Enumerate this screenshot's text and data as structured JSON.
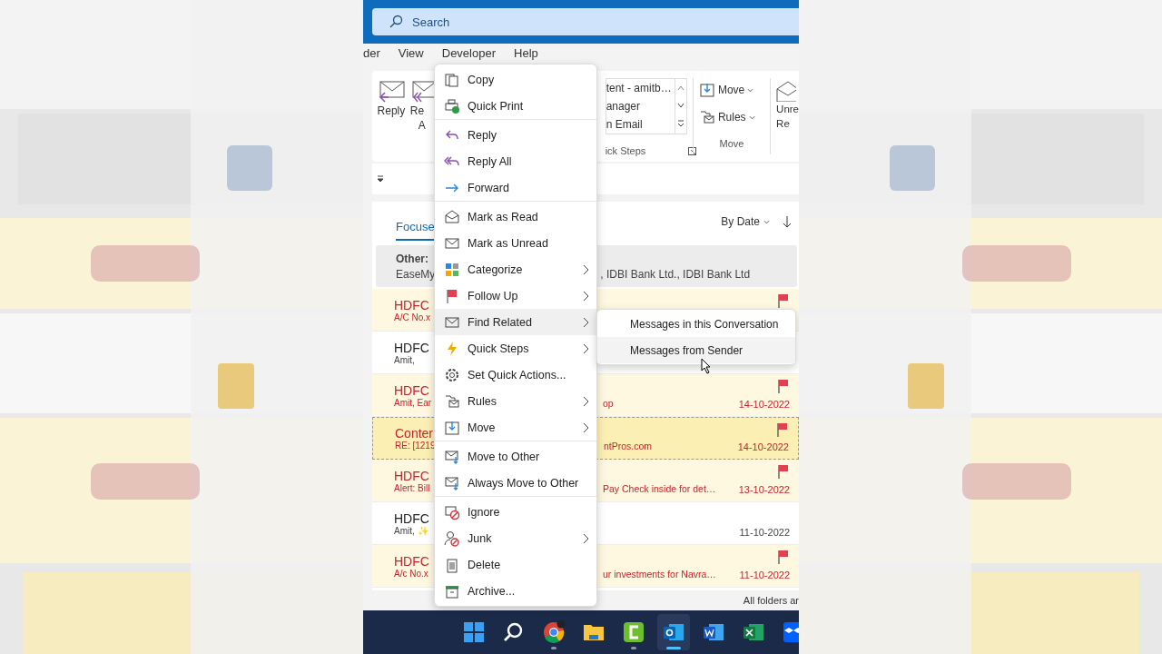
{
  "search": {
    "placeholder": "Search"
  },
  "menu_tabs": [
    "der",
    "View",
    "Developer",
    "Help"
  ],
  "ribbon": {
    "reply": "Reply",
    "reply_all_lines": [
      "Re",
      "A"
    ],
    "quick_steps": {
      "items": [
        "tent - amitb…",
        "anager",
        "n Email"
      ],
      "label": "ick Steps"
    },
    "move_group": {
      "items": [
        {
          "kind": "move",
          "label": "Move"
        },
        {
          "kind": "rules",
          "label": "Rules"
        }
      ],
      "label": "Move"
    },
    "unread_lines": [
      "Unre",
      "Re"
    ]
  },
  "message_list": {
    "tab": "Focuse",
    "sort": "By Date",
    "other": {
      "label": "Other:",
      "senders_start": "EaseMy",
      "senders_end": ", IDBI Bank Ltd., IDBI Bank Ltd"
    },
    "rows": [
      {
        "sender": "HDFC",
        "preview": "A/C No.x",
        "flagged": true,
        "unread": true,
        "selected": false
      },
      {
        "sender": "HDFC",
        "preview": "Amit,",
        "flagged": false,
        "unread": false,
        "selected": false
      },
      {
        "sender": "HDFC",
        "preview": "Amit, Ear",
        "tail": "op",
        "date": "14-10-2022",
        "flagged": true,
        "unread": true,
        "selected": false
      },
      {
        "sender": "Conter",
        "preview": "RE: [1219",
        "tail": "ntPros.com",
        "date": "14-10-2022",
        "flagged": true,
        "unread": true,
        "selected": true
      },
      {
        "sender": "HDFC",
        "preview": "Alert: Bill",
        "tail": "Pay Check inside for det…",
        "date": "13-10-2022",
        "flagged": true,
        "unread": true,
        "selected": false
      },
      {
        "sender": "HDFC",
        "preview": "Amit, ✨",
        "date": "11-10-2022",
        "flagged": false,
        "unread": false,
        "selected": false
      },
      {
        "sender": "HDFC",
        "preview": "A/c No.x",
        "tail": "ur investments for Navra…",
        "date": "11-10-2022",
        "flagged": true,
        "unread": true,
        "selected": false
      }
    ]
  },
  "status_bar": "All folders ar",
  "context_menu": {
    "items": [
      {
        "kind": "copy",
        "label": "Copy",
        "submenu": false,
        "selected": false,
        "separator_after": false
      },
      {
        "kind": "print",
        "label": "Quick Print",
        "submenu": false,
        "selected": false,
        "separator_after": true
      },
      {
        "kind": "reply",
        "label": "Reply",
        "submenu": false,
        "selected": false,
        "separator_after": false
      },
      {
        "kind": "replyall",
        "label": "Reply All",
        "submenu": false,
        "selected": false,
        "separator_after": false
      },
      {
        "kind": "forward",
        "label": "Forward",
        "submenu": false,
        "selected": false,
        "separator_after": true
      },
      {
        "kind": "read",
        "label": "Mark as Read",
        "submenu": false,
        "selected": false,
        "separator_after": false
      },
      {
        "kind": "unread",
        "label": "Mark as Unread",
        "submenu": false,
        "selected": false,
        "separator_after": false
      },
      {
        "kind": "categorize",
        "label": "Categorize",
        "submenu": true,
        "selected": false,
        "separator_after": false
      },
      {
        "kind": "flag",
        "label": "Follow Up",
        "submenu": true,
        "selected": false,
        "separator_after": false
      },
      {
        "kind": "find",
        "label": "Find Related",
        "submenu": true,
        "selected": true,
        "separator_after": false
      },
      {
        "kind": "quicksteps",
        "label": "Quick Steps",
        "submenu": true,
        "selected": false,
        "separator_after": false
      },
      {
        "kind": "gear",
        "label": "Set Quick Actions...",
        "submenu": false,
        "selected": false,
        "separator_after": false
      },
      {
        "kind": "rules",
        "label": "Rules",
        "submenu": true,
        "selected": false,
        "separator_after": false
      },
      {
        "kind": "move",
        "label": "Move",
        "submenu": true,
        "selected": false,
        "separator_after": true
      },
      {
        "kind": "moveother",
        "label": "Move to Other",
        "submenu": false,
        "selected": false,
        "separator_after": false
      },
      {
        "kind": "moveother",
        "label": "Always Move to Other",
        "submenu": false,
        "selected": false,
        "separator_after": true
      },
      {
        "kind": "ignore",
        "label": "Ignore",
        "submenu": false,
        "selected": false,
        "separator_after": false
      },
      {
        "kind": "junk",
        "label": "Junk",
        "submenu": true,
        "selected": false,
        "separator_after": false
      },
      {
        "kind": "delete",
        "label": "Delete",
        "submenu": false,
        "selected": false,
        "separator_after": false
      },
      {
        "kind": "archive",
        "label": "Archive...",
        "submenu": false,
        "selected": false,
        "separator_after": false
      }
    ]
  },
  "submenu": {
    "items": [
      {
        "label": "Messages in this Conversation",
        "selected": false
      },
      {
        "label": "Messages from Sender",
        "selected": true
      }
    ]
  },
  "taskbar": {
    "apps": [
      {
        "kind": "start",
        "running": false,
        "selected": false
      },
      {
        "kind": "search",
        "running": false,
        "selected": false
      },
      {
        "kind": "chrome",
        "running": true,
        "selected": false
      },
      {
        "kind": "explorer",
        "running": false,
        "selected": false
      },
      {
        "kind": "camtasia",
        "running": true,
        "selected": false
      },
      {
        "kind": "outlook",
        "running": true,
        "selected": true
      },
      {
        "kind": "word",
        "running": false,
        "selected": false
      },
      {
        "kind": "excel",
        "running": false,
        "selected": false
      },
      {
        "kind": "dropbox",
        "running": false,
        "selected": false
      }
    ]
  }
}
